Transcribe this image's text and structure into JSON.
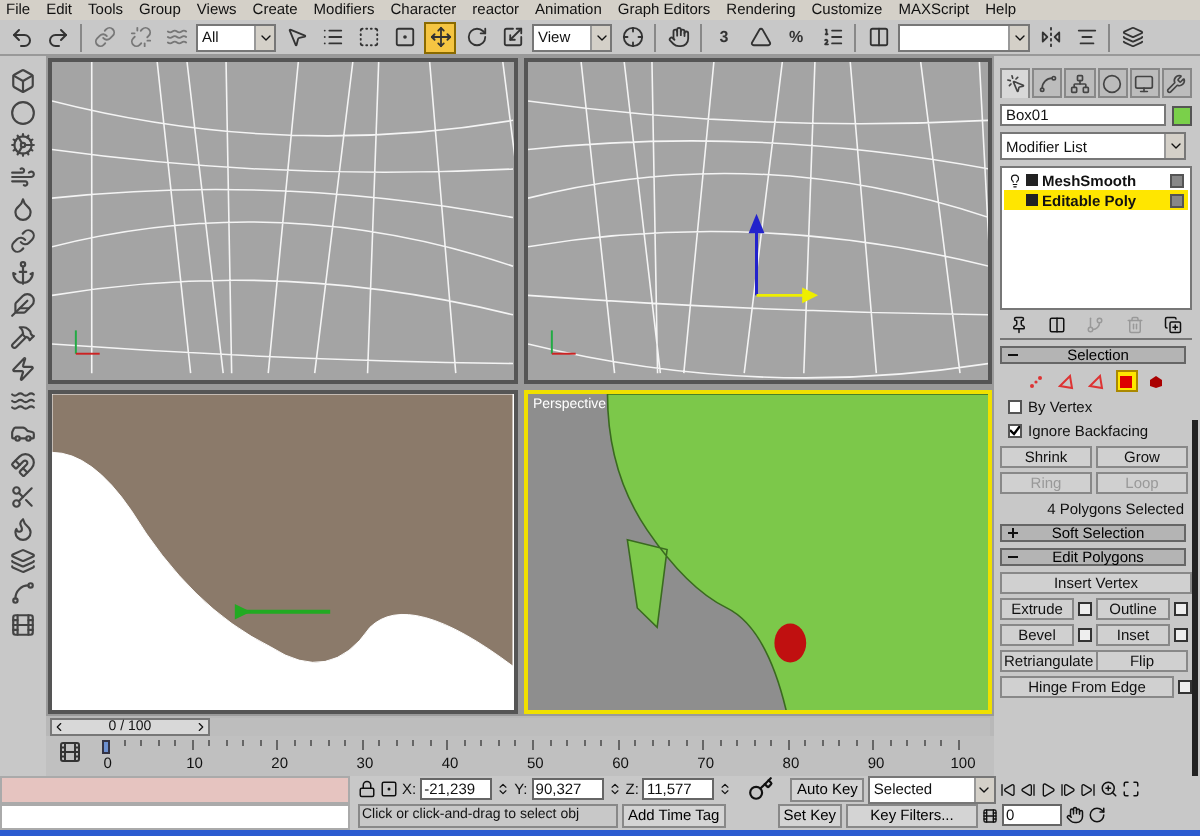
{
  "menu": [
    "File",
    "Edit",
    "Tools",
    "Group",
    "Views",
    "Create",
    "Modifiers",
    "Character",
    "reactor",
    "Animation",
    "Graph Editors",
    "Rendering",
    "Customize",
    "MAXScript",
    "Help"
  ],
  "toolbar": {
    "selection_filter": "All",
    "reference_coord": "View",
    "snaps": [
      "3",
      "%"
    ],
    "transform_tools": [
      {
        "selected": true
      },
      {
        "selected": false
      },
      {
        "selected": false
      }
    ]
  },
  "viewports": [
    {
      "kind": "wireframe",
      "active": false
    },
    {
      "kind": "wireframe",
      "active": false
    },
    {
      "kind": "textured",
      "active": false
    },
    {
      "kind": "shaded",
      "label": "Perspective",
      "active": true
    }
  ],
  "command_panel": {
    "tabs": [
      {
        "selected": true
      },
      {
        "selected": false
      },
      {
        "selected": false
      },
      {
        "selected": false
      },
      {
        "selected": false
      },
      {
        "selected": false
      }
    ],
    "object_name": "Box01",
    "modifier_list": "Modifier List",
    "stack": [
      {
        "label": "MeshSmooth",
        "selected": false,
        "bulb": true
      },
      {
        "label": "Editable Poly",
        "selected": true,
        "bulb": false
      }
    ],
    "rollouts": [
      {
        "title": "Selection",
        "expanded": true
      },
      {
        "title": "Soft Selection",
        "expanded": false
      },
      {
        "title": "Edit Polygons",
        "expanded": true
      }
    ],
    "subobject_modes": [
      {
        "selected": false
      },
      {
        "selected": false
      },
      {
        "selected": false
      },
      {
        "selected": true
      },
      {
        "selected": false
      }
    ],
    "checkboxes": [
      {
        "label": "By Vertex",
        "checked": false
      },
      {
        "label": "Ignore Backfacing",
        "checked": true
      }
    ],
    "selection_buttons": [
      {
        "label": "Shrink",
        "disabled": false
      },
      {
        "label": "Grow",
        "disabled": false
      },
      {
        "label": "Ring",
        "disabled": true
      },
      {
        "label": "Loop",
        "disabled": true
      }
    ],
    "selection_info": "4 Polygons Selected",
    "edit_buttons": [
      {
        "label": "Insert Vertex",
        "settings": false,
        "wide": true
      },
      {
        "label": "Extrude",
        "settings": true,
        "wide": false
      },
      {
        "label": "Outline",
        "settings": true,
        "wide": false
      },
      {
        "label": "Bevel",
        "settings": true,
        "wide": false
      },
      {
        "label": "Inset",
        "settings": true,
        "wide": false
      },
      {
        "label": "Retriangulate",
        "settings": false,
        "wide": false
      },
      {
        "label": "Flip",
        "settings": false,
        "wide": false
      },
      {
        "label": "Hinge From Edge",
        "settings": true,
        "wide": true
      }
    ]
  },
  "time_slider": {
    "label": "0 / 100",
    "level": 0
  },
  "ruler_labels": [
    "0",
    "10",
    "20",
    "30",
    "40",
    "50",
    "60",
    "70",
    "80",
    "90",
    "100"
  ],
  "status": {
    "coords": [
      {
        "label": "X:",
        "value": "-21,239"
      },
      {
        "label": "Y:",
        "value": "90,327"
      },
      {
        "label": "Z:",
        "value": "11,577"
      }
    ],
    "prompt": "Click or click-and-drag to select obj",
    "time_tag": "Add Time Tag",
    "auto_key": "Auto Key",
    "set_key": "Set Key",
    "key_mode": "Selected",
    "key_filters": "Key Filters...",
    "frame": "0"
  }
}
